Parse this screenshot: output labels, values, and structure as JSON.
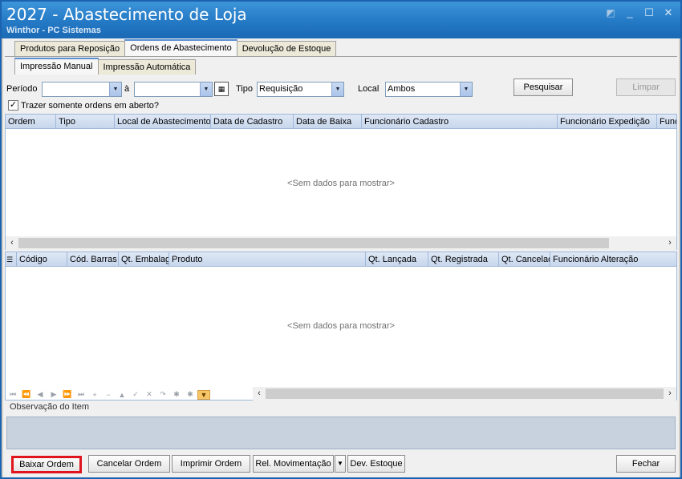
{
  "window": {
    "title": "2027 - Abastecimento de Loja",
    "subtitle": "Winthor - PC Sistemas",
    "controls": {
      "edit": "◩",
      "minimize": "_",
      "maximize": "☐",
      "close": "✕"
    }
  },
  "main_tabs": [
    {
      "label": "Produtos para Reposição",
      "active": false
    },
    {
      "label": "Ordens de Abastecimento",
      "active": true
    },
    {
      "label": "Devolução de Estoque",
      "active": false
    }
  ],
  "sub_tabs": [
    {
      "label": "Impressão Manual",
      "active": true
    },
    {
      "label": "Impressão Automática",
      "active": false
    }
  ],
  "filters": {
    "periodo_label": "Período",
    "periodo_inicio": "",
    "a_label": "à",
    "periodo_fim": "",
    "tipo_label": "Tipo",
    "tipo_value": "Requisição",
    "local_label": "Local",
    "local_value": "Ambos",
    "pesquisar": "Pesquisar",
    "limpar": "Limpar",
    "somente_abertas_label": "Trazer somente ordens em aberto?",
    "somente_abertas_checked": true
  },
  "orders_grid": {
    "columns": [
      "Ordem",
      "Tipo",
      "Local de Abastecimento",
      "Data de Cadastro",
      "Data de Baixa",
      "Funcionário Cadastro",
      "Funcionário Expedição",
      "Func"
    ],
    "empty_text": "<Sem dados para mostrar>"
  },
  "items_grid": {
    "columns": [
      "Código",
      "Cód. Barras",
      "Qt. Embalag",
      "Produto",
      "Qt. Lançada",
      "Qt. Registrada",
      "Qt. Cancelad",
      "Funcionário Alteração"
    ],
    "empty_text": "<Sem dados para mostrar>"
  },
  "navigator": [
    "⏮",
    "⏪",
    "◀",
    "▶",
    "⏩",
    "⏭",
    "+",
    "−",
    "▲",
    "✓",
    "✕",
    "↷",
    "✱",
    "✱",
    "▼"
  ],
  "observacao_label": "Observação do Item",
  "footer_buttons": {
    "baixar": "Baixar Ordem",
    "cancelar": "Cancelar Ordem",
    "imprimir": "Imprimir Ordem",
    "rel_mov": "Rel. Movimentação",
    "dev_estoque": "Dev. Estoque",
    "fechar": "Fechar"
  },
  "accent_colors": {
    "title": "#2479c5",
    "highlight_border": "#e0141c"
  }
}
